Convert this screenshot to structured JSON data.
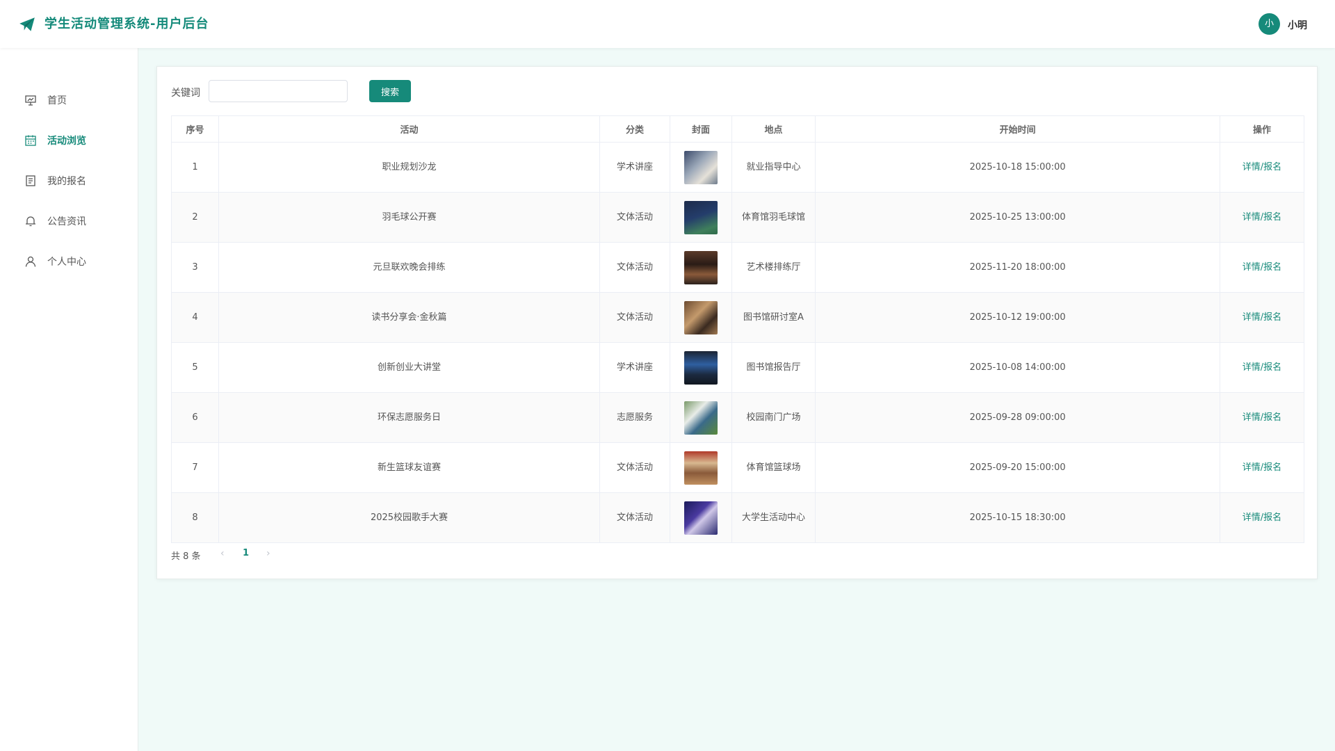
{
  "header": {
    "title": "学生活动管理系统-用户后台",
    "avatar_text": "小",
    "username": "小明",
    "accent": "#168a7a"
  },
  "sidebar": {
    "items": [
      {
        "label": "首页",
        "icon": "presentation-icon"
      },
      {
        "label": "活动浏览",
        "icon": "calendar-icon",
        "active": true
      },
      {
        "label": "我的报名",
        "icon": "document-icon"
      },
      {
        "label": "公告资讯",
        "icon": "bell-icon"
      },
      {
        "label": "个人中心",
        "icon": "user-icon"
      }
    ]
  },
  "search": {
    "label": "关键词",
    "value": "",
    "placeholder": "",
    "button": "搜索"
  },
  "table": {
    "columns": [
      "序号",
      "活动",
      "分类",
      "封面",
      "地点",
      "开始时间",
      "操作"
    ],
    "rows": [
      {
        "no": "1",
        "name": "职业规划沙龙",
        "category": "学术讲座",
        "location": "就业指导中心",
        "start": "2025-10-18 15:00:00",
        "action": "详情/报名"
      },
      {
        "no": "2",
        "name": "羽毛球公开赛",
        "category": "文体活动",
        "location": "体育馆羽毛球馆",
        "start": "2025-10-25 13:00:00",
        "action": "详情/报名"
      },
      {
        "no": "3",
        "name": "元旦联欢晚会排练",
        "category": "文体活动",
        "location": "艺术楼排练厅",
        "start": "2025-11-20 18:00:00",
        "action": "详情/报名"
      },
      {
        "no": "4",
        "name": "读书分享会·金秋篇",
        "category": "文体活动",
        "location": "图书馆研讨室A",
        "start": "2025-10-12 19:00:00",
        "action": "详情/报名"
      },
      {
        "no": "5",
        "name": "创新创业大讲堂",
        "category": "学术讲座",
        "location": "图书馆报告厅",
        "start": "2025-10-08 14:00:00",
        "action": "详情/报名"
      },
      {
        "no": "6",
        "name": "环保志愿服务日",
        "category": "志愿服务",
        "location": "校园南门广场",
        "start": "2025-09-28 09:00:00",
        "action": "详情/报名"
      },
      {
        "no": "7",
        "name": "新生篮球友谊赛",
        "category": "文体活动",
        "location": "体育馆篮球场",
        "start": "2025-09-20 15:00:00",
        "action": "详情/报名"
      },
      {
        "no": "8",
        "name": "2025校园歌手大赛",
        "category": "文体活动",
        "location": "大学生活动中心",
        "start": "2025-10-15 18:30:00",
        "action": "详情/报名"
      }
    ]
  },
  "pagination": {
    "total": "共 8 条",
    "current": "1"
  }
}
